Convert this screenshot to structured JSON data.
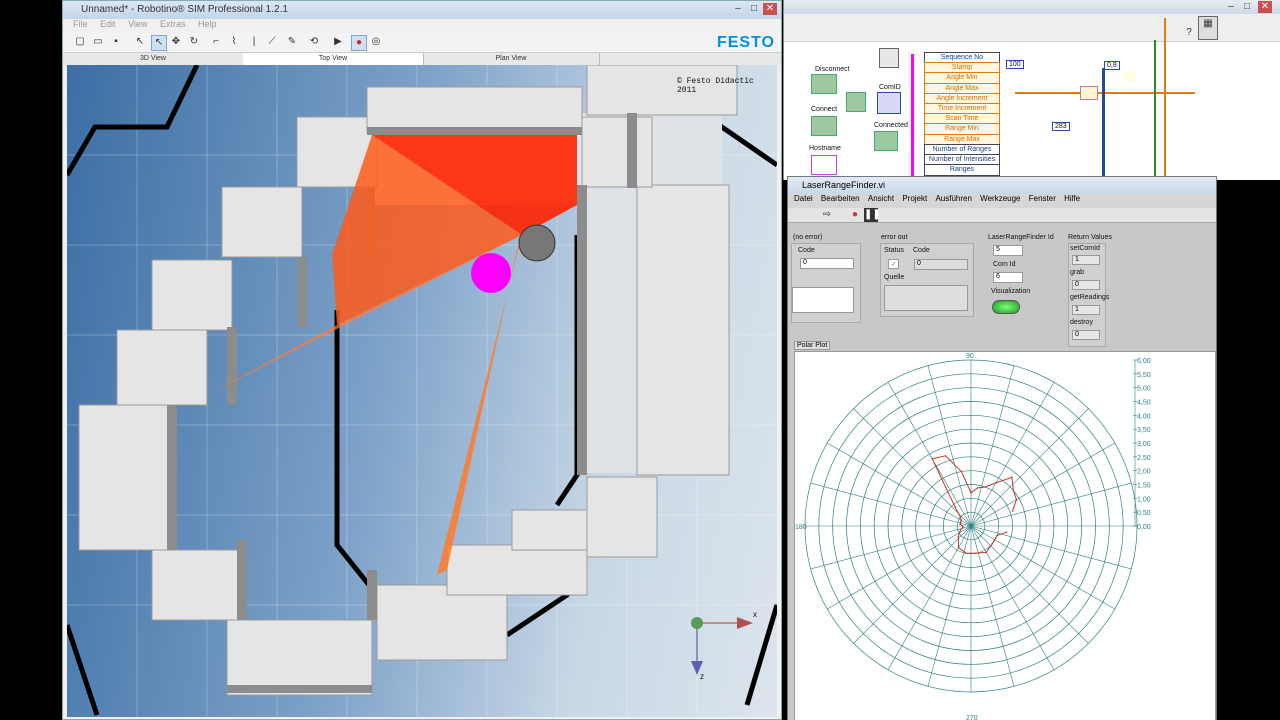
{
  "sim": {
    "title": "Unnamed* - Robotino® SIM Professional 1.2.1",
    "menu": [
      "File",
      "Edit",
      "View",
      "Extras",
      "Help"
    ],
    "brand": "FESTO",
    "tabs": [
      "3D View",
      "Top View",
      "Plan View"
    ],
    "copyright": "© Festo Didactic 2011",
    "axis_x": "x",
    "axis_z": "z"
  },
  "bd": {
    "disconnect": "Disconnect",
    "connect": "Connect",
    "hostname": "Hostname",
    "comid": "ComID",
    "connected": "Connected",
    "const_100": "100",
    "const_08": "0,8",
    "const_283": "283",
    "cluster": [
      "Sequence No",
      "Stamp",
      "Angle Min",
      "Angle Max",
      "Angle Increment",
      "Time Increment",
      "Scan Time",
      "Range Min",
      "Range Max",
      "Number of Ranges",
      "Number of Intensities",
      "Ranges"
    ]
  },
  "fp": {
    "title": "LaserRangeFinder.vi",
    "menu": [
      "Datei",
      "Bearbeiten",
      "Ansicht",
      "Projekt",
      "Ausführen",
      "Werkzeuge",
      "Fenster",
      "Hilfe"
    ],
    "no_error": "(no error)",
    "code_label": "Code",
    "code_value": "0",
    "error_out": "error out",
    "status_label": "Status",
    "code2_label": "Code",
    "code2_value": "0",
    "quelle_label": "Quelle",
    "lrf_label": "LaserRangeFinder Id",
    "lrf_value": "5",
    "comid_label": "Com Id",
    "comid_value": "6",
    "visualization": "Visualization",
    "return_values": "Return Values",
    "returns": [
      {
        "label": "setComId",
        "value": "1"
      },
      {
        "label": "grab",
        "value": "0"
      },
      {
        "label": "getReadings",
        "value": "1"
      },
      {
        "label": "destroy",
        "value": "0"
      }
    ],
    "polar_tab": "Polar Plot"
  },
  "chart_data": {
    "type": "polar",
    "title": "Polar Plot",
    "radial_ticks": [
      "0,00",
      "0,50",
      "1,00",
      "1,50",
      "2,00",
      "2,50",
      "3,00",
      "3,50",
      "4,00",
      "4,50",
      "5,00",
      "5,50",
      "6,00"
    ],
    "angle_labels": [
      "90",
      "180",
      "270"
    ],
    "rlim": [
      0,
      6
    ],
    "grid": true,
    "series": [
      {
        "angles_deg": [
          20,
          30,
          40,
          50,
          60,
          70,
          80,
          90,
          100,
          110,
          120,
          130,
          140,
          150,
          160,
          170,
          180,
          190,
          200,
          220,
          240,
          260,
          280,
          300,
          320,
          340,
          350
        ],
        "r": [
          1.6,
          1.9,
          2.0,
          2.3,
          1.8,
          1.5,
          1.4,
          1.2,
          2.0,
          2.7,
          2.8,
          0.9,
          0.5,
          0.4,
          0.4,
          0.4,
          0.3,
          0.3,
          0.4,
          0.6,
          0.9,
          1.0,
          1.0,
          1.1,
          1.0,
          1.0,
          1.3
        ],
        "color": "#c0392b"
      }
    ]
  }
}
